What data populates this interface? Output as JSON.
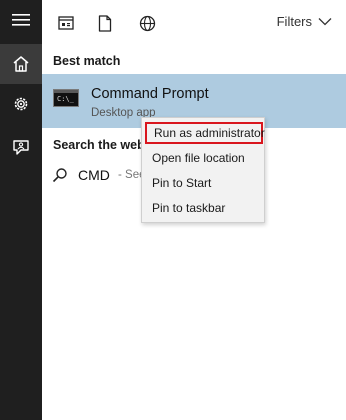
{
  "rail": {
    "items": [
      {
        "icon": "hamburger-menu-icon"
      },
      {
        "icon": "home-icon",
        "active": true
      },
      {
        "icon": "settings-gear-icon"
      },
      {
        "icon": "feedback-person-icon"
      }
    ]
  },
  "topbar": {
    "icons": [
      "apps-view-icon",
      "document-icon",
      "web-globe-icon"
    ],
    "filters_label": "Filters"
  },
  "best_match": {
    "heading": "Best match",
    "title": "Command Prompt",
    "subtitle": "Desktop app"
  },
  "search_web": {
    "heading": "Search the web",
    "query": "CMD",
    "hint": "- See w"
  },
  "context_menu": {
    "items": [
      {
        "label": "Run as administrator",
        "highlighted": true
      },
      {
        "label": "Open file location"
      },
      {
        "label": "Pin to Start"
      },
      {
        "label": "Pin to taskbar"
      }
    ]
  },
  "colors": {
    "rail_bg": "#1f1f1f",
    "best_match_bg": "#aecbe0",
    "highlight_border": "#d9161e",
    "menu_bg": "#f2f2f2"
  }
}
